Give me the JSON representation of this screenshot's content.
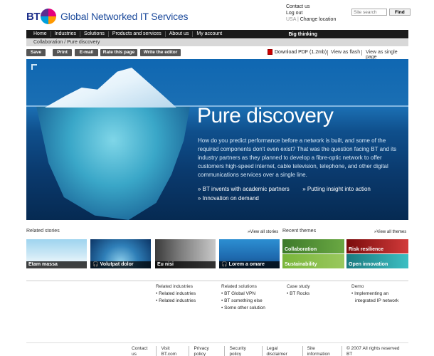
{
  "header": {
    "brand": "BT",
    "site_name": "Global Networked IT Services",
    "links": [
      "Contact us",
      "Log out"
    ],
    "region": "USA",
    "change_location": "Change location",
    "search_placeholder": "Site search",
    "search_button": "Find"
  },
  "nav": {
    "items": [
      "Home",
      "Industries",
      "Solutions",
      "Products and services",
      "About us",
      "My account"
    ],
    "big_thinking": "Big thinking"
  },
  "breadcrumb": "Collaboration / Pure discovery",
  "toolbar": {
    "buttons": [
      "Save",
      "Print",
      "E-mail",
      "Rate this page",
      "Write the editor"
    ],
    "pdf": "Download PDF (1.2mb)",
    "view_flash": "View as flash",
    "view_single": "View as single page"
  },
  "hero": {
    "title": "Pure discovery",
    "body": "How do you predict performance before a network is built, and some of the required components don't even exist? That was the question facing BT and its industry partners as they planned to develop a fibre-optic network to offer customers high-speed internet, cable television, telephone, and other digital communications services over a single line.",
    "links": [
      "» BT invents with academic partners",
      "» Putting insight into action",
      "» Innovation on demand"
    ]
  },
  "related_stories": {
    "title": "Related stories",
    "view_all": "»View all stories",
    "items": [
      "Etam massa",
      "Volutpat dolor",
      "Eu nisi",
      "Lorem a omare"
    ]
  },
  "recent_themes": {
    "title": "Recent themes",
    "view_all": "»View all themes",
    "items": [
      "Collaboration",
      "Risk resilience",
      "Sustainability",
      "Open innovation"
    ]
  },
  "lists": {
    "industries": {
      "title": "Related industries",
      "items": [
        "• Related industries",
        "• Related industries"
      ]
    },
    "solutions": {
      "title": "Related solutions",
      "items": [
        "• BT Global VPN",
        "• BT something else",
        "• Some other solution"
      ]
    },
    "case_study": {
      "title": "Case study",
      "items": [
        "• BT Rocks"
      ]
    },
    "demo": {
      "title": "Demo",
      "items": [
        "• Implementing an",
        "integrated IP network"
      ]
    }
  },
  "footer": [
    "Contact us",
    "Visit BT.com",
    "Privacy policy",
    "Security policy",
    "Legal disclaimer",
    "Site information",
    "© 2007 All rights reserved BT"
  ]
}
